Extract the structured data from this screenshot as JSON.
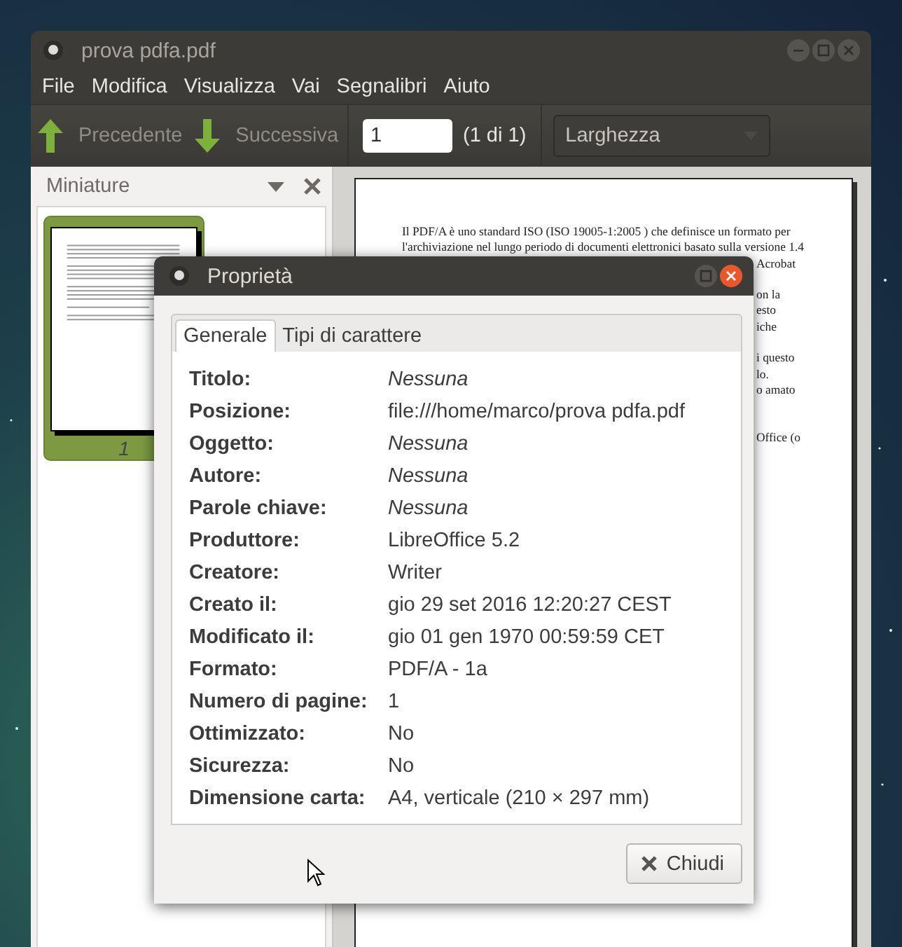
{
  "window": {
    "title": "prova pdfa.pdf"
  },
  "menu": [
    "File",
    "Modifica",
    "Visualizza",
    "Vai",
    "Segnalibri",
    "Aiuto"
  ],
  "toolbar": {
    "previous": "Precedente",
    "next": "Successiva",
    "page_field": "1",
    "page_count": "(1 di 1)",
    "zoom": "Larghezza"
  },
  "sidebar": {
    "title": "Miniature",
    "thumbnails": [
      {
        "label": "1",
        "selected": true
      }
    ]
  },
  "document": {
    "lines": [
      {
        "kind": "full",
        "text": "Il PDF/A è uno standard ISO (ISO 19005-1:2005 ) che definisce un formato per"
      },
      {
        "kind": "full",
        "text": "l'archiviazione nel lungo periodo di documenti elettronici basato sulla versione 1.4"
      },
      {
        "kind": "fragment",
        "text": "Acrobat"
      },
      {
        "kind": "gap"
      },
      {
        "kind": "fragment",
        "text": "on la"
      },
      {
        "kind": "fragment",
        "text": "esto"
      },
      {
        "kind": "fragment",
        "text": "iche"
      },
      {
        "kind": "gap"
      },
      {
        "kind": "fragment",
        "text": "i questo"
      },
      {
        "kind": "fragment",
        "text": "lo."
      },
      {
        "kind": "fragment",
        "text": "o amato"
      },
      {
        "kind": "gap"
      },
      {
        "kind": "gap"
      },
      {
        "kind": "fragment",
        "text": "Office (o"
      }
    ]
  },
  "dialog": {
    "title": "Proprietà",
    "tabs": [
      {
        "label": "Generale",
        "selected": true
      },
      {
        "label": "Tipi di carattere",
        "selected": false
      }
    ],
    "properties": [
      {
        "label": "Titolo:",
        "value": "Nessuna",
        "italic": true
      },
      {
        "label": "Posizione:",
        "value": "file:///home/marco/prova pdfa.pdf",
        "italic": false
      },
      {
        "label": "Oggetto:",
        "value": "Nessuna",
        "italic": true
      },
      {
        "label": "Autore:",
        "value": "Nessuna",
        "italic": true
      },
      {
        "label": "Parole chiave:",
        "value": "Nessuna",
        "italic": true
      },
      {
        "label": "Produttore:",
        "value": "LibreOffice 5.2",
        "italic": false
      },
      {
        "label": "Creatore:",
        "value": "Writer",
        "italic": false
      },
      {
        "label": "Creato il:",
        "value": "gio 29 set 2016 12:20:27 CEST",
        "italic": false
      },
      {
        "label": "Modificato il:",
        "value": "gio 01 gen 1970 00:59:59 CET",
        "italic": false
      },
      {
        "label": "Formato:",
        "value": "PDF/A - 1a",
        "italic": false
      },
      {
        "label": "Numero di pagine:",
        "value": "1",
        "italic": false
      },
      {
        "label": "Ottimizzato:",
        "value": "No",
        "italic": false
      },
      {
        "label": "Sicurezza:",
        "value": "No",
        "italic": false
      },
      {
        "label": "Dimensione carta:",
        "value": "A4, verticale (210 × 297 mm)",
        "italic": false
      }
    ],
    "close_button": "Chiudi"
  }
}
